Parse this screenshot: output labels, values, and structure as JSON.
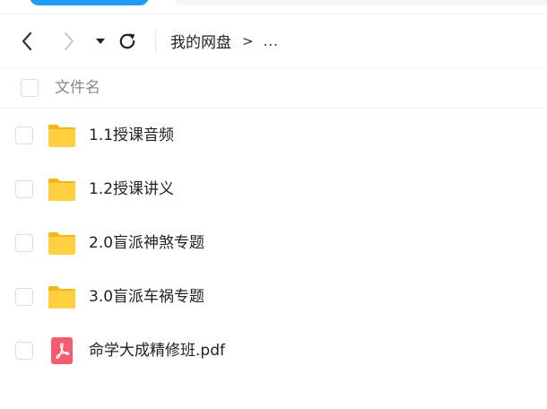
{
  "colors": {
    "accent": "#1f9cf5",
    "folder": "#ffcf3f",
    "pdf": "#f55c6f",
    "divider": "#eef0f3"
  },
  "nav": {
    "back_icon": "chevron-left-icon",
    "forward_icon": "chevron-right-icon",
    "history_icon": "caret-down-icon",
    "refresh_icon": "refresh-icon"
  },
  "breadcrumb": {
    "root": "我的网盘",
    "separator": ">",
    "more": "..."
  },
  "list_header": {
    "name_column": "文件名"
  },
  "files": [
    {
      "name": "1.1授课音频",
      "type": "folder",
      "icon": "folder-icon"
    },
    {
      "name": "1.2授课讲义",
      "type": "folder",
      "icon": "folder-icon"
    },
    {
      "name": "2.0盲派神煞专题",
      "type": "folder",
      "icon": "folder-icon"
    },
    {
      "name": "3.0盲派车祸专题",
      "type": "folder",
      "icon": "folder-icon"
    },
    {
      "name": "命学大成精修班.pdf",
      "type": "pdf",
      "icon": "pdf-icon"
    }
  ]
}
